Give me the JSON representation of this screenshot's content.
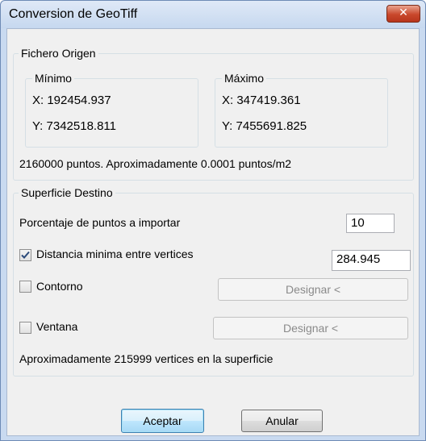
{
  "window": {
    "title": "Conversion de GeoTiff",
    "close_icon": "close-icon"
  },
  "origin": {
    "legend": "Fichero Origen",
    "min": {
      "legend": "Mínimo",
      "x": "X: 192454.937",
      "y": "Y: 7342518.811"
    },
    "max": {
      "legend": "Máximo",
      "x": "X: 347419.361",
      "y": "Y: 7455691.825"
    },
    "summary": "2160000 puntos. Aproximadamente 0.0001 puntos/m2"
  },
  "dest": {
    "legend": "Superficie Destino",
    "percent_label": "Porcentaje de puntos a importar",
    "percent_value": "10",
    "distance_label": "Distancia minima entre vertices",
    "distance_checked": true,
    "distance_value": "284.945",
    "contour_label": "Contorno",
    "contour_checked": false,
    "contour_button": "Designar <",
    "window_label": "Ventana",
    "window_checked": false,
    "window_button": "Designar <",
    "summary": "Aproximadamente 215999 vertices en la superficie"
  },
  "buttons": {
    "ok": "Aceptar",
    "cancel": "Anular"
  },
  "colors": {
    "title_bar": "#c6d8ef",
    "close_button": "#c9482c",
    "dialog_bg": "#f0f0f0",
    "default_button": "#3c7fb1"
  }
}
